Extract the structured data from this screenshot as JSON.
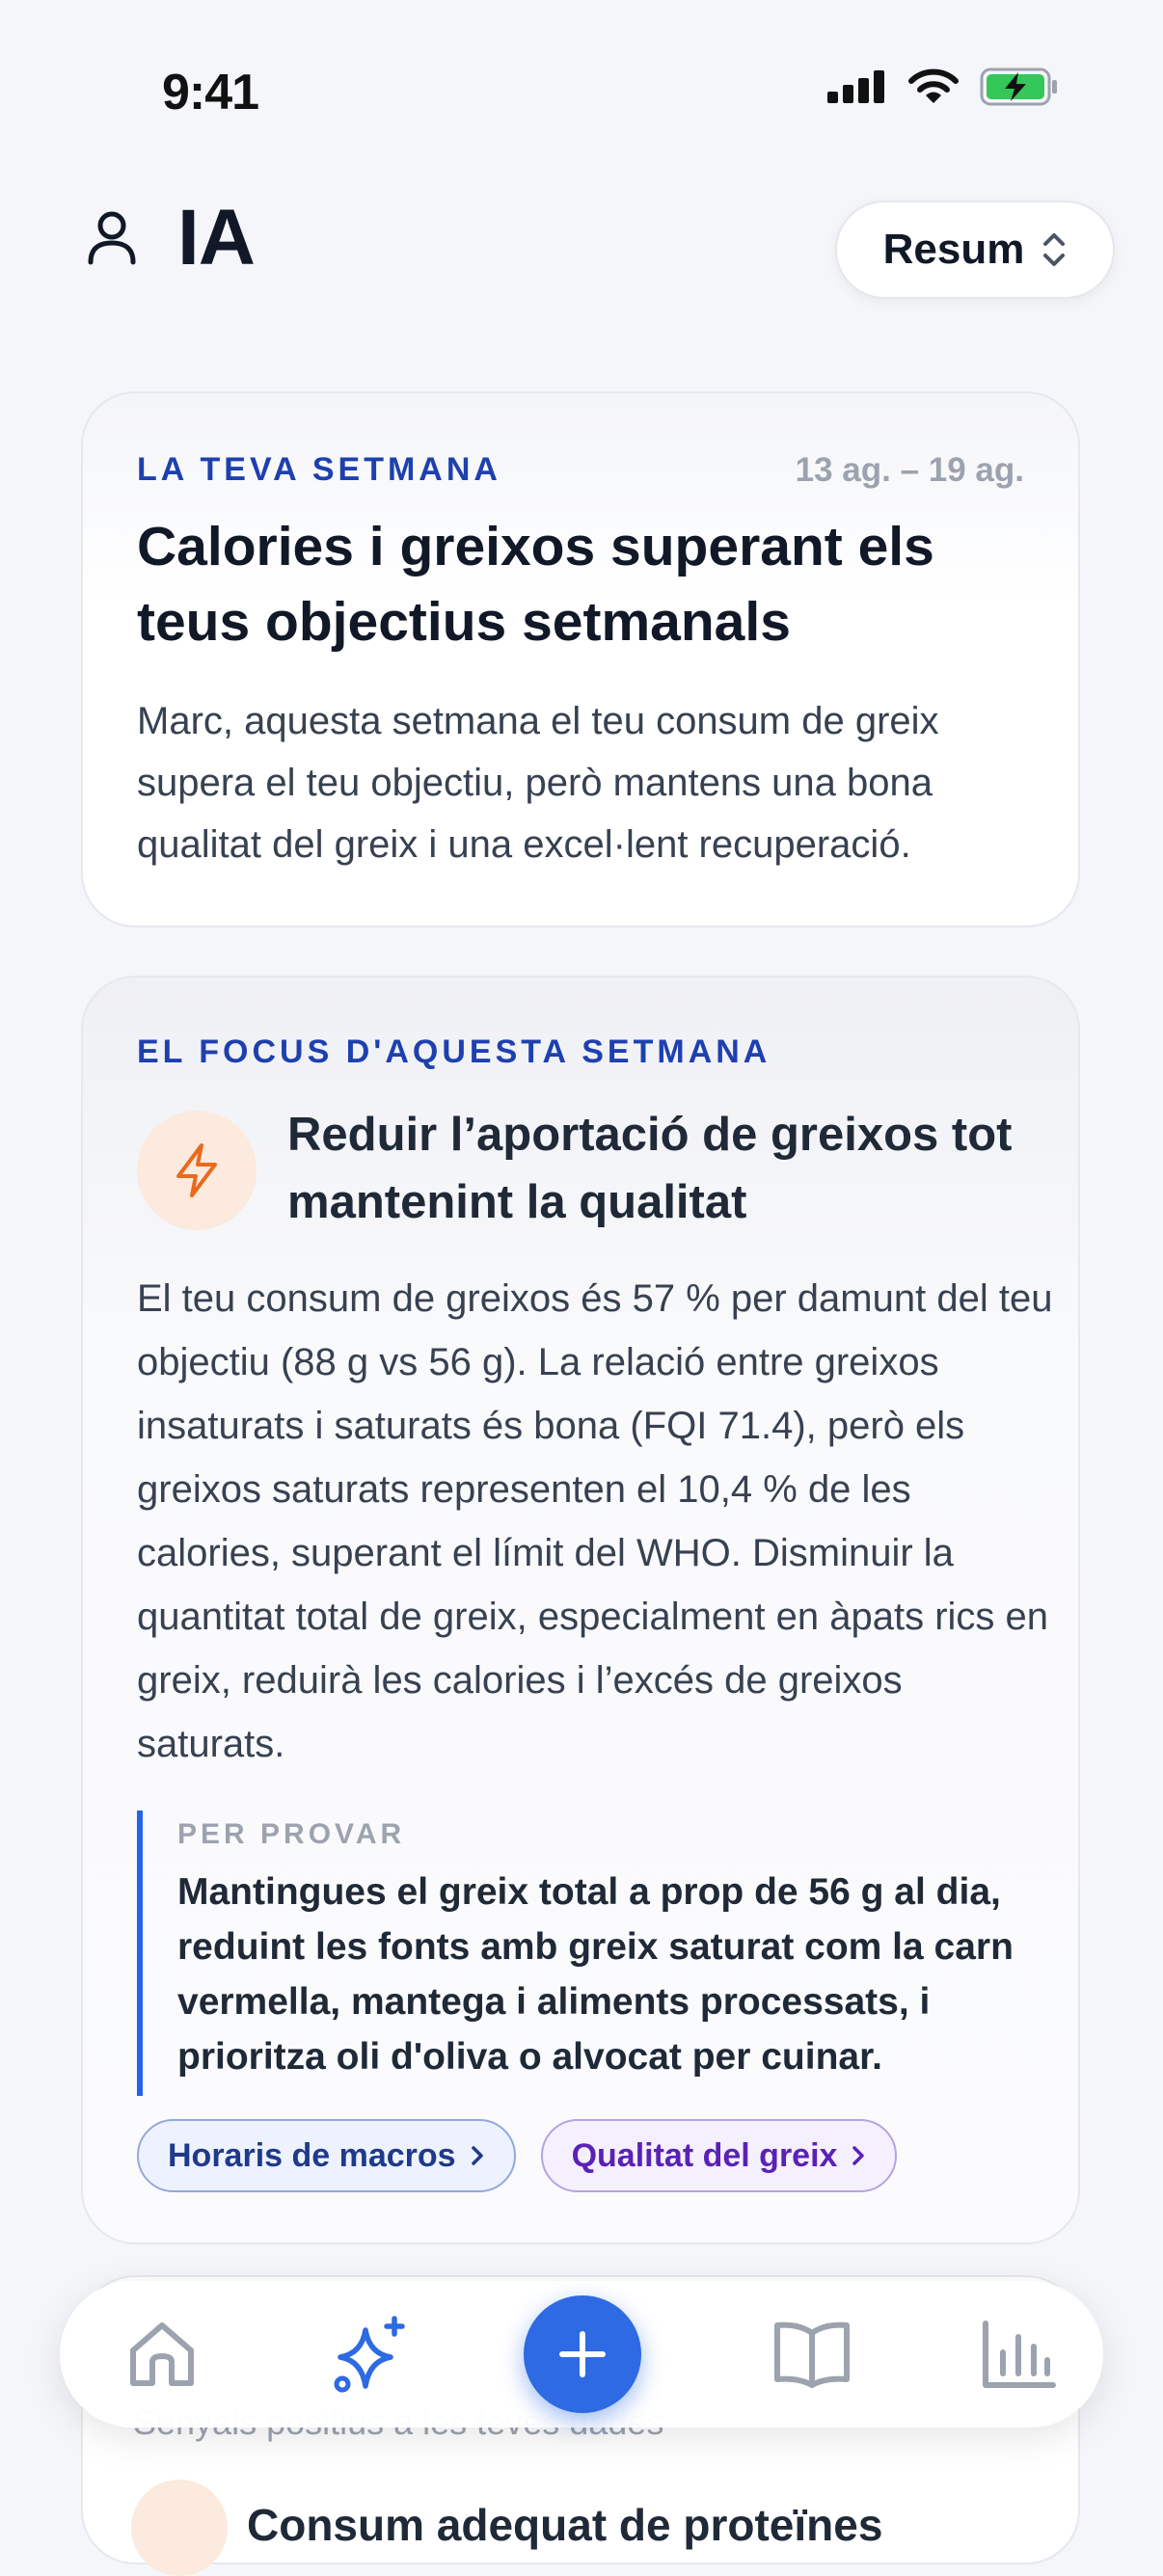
{
  "status_bar": {
    "time": "9:41"
  },
  "header": {
    "title": "IA",
    "view_selector": {
      "selected": "Resum"
    }
  },
  "week_card": {
    "eyebrow": "LA TEVA SETMANA",
    "date_range": "13 ag. – 19 ag.",
    "headline": "Calories i greixos superant els teus objectius setmanals",
    "body": "Marc, aquesta setmana el teu consum de greix supera el teu objectiu, però mantens una bona qualitat del greix i una excel·lent recuperació."
  },
  "focus_card": {
    "eyebrow": "EL FOCUS D'AQUESTA SETMANA",
    "icon": "lightning-icon",
    "title": "Reduir l’aportació de greixos tot mantenint la qualitat",
    "body": "El teu consum de greixos és 57 % per damunt del teu objectiu (88 g vs 56 g). La relació entre greixos insaturats i saturats és bona (FQI 71.4), però els greixos saturats representen el 10,4 % de les calories, superant el límit del WHO. Disminuir la quantitat total de greix, especialment en àpats rics en greix, reduirà les calories i l’excés de greixos saturats.",
    "tip": {
      "label": "PER PROVAR",
      "text": "Mantingues el greix total a prop de 56 g al dia, reduint les fonts amb greix saturat com la carn vermella, mantega i aliments processats, i prioritza oli d'oliva o alvocat per cuinar."
    },
    "chips": [
      {
        "label": "Horaris de macros",
        "color": "#1e3a8a"
      },
      {
        "label": "Qualitat del greix",
        "color": "#5b21b6"
      }
    ]
  },
  "signals_card": {
    "subtitle": "Senyals positius a les teves dades",
    "first_item": "Consum adequat de proteïnes"
  },
  "tab_bar": {
    "items": [
      "home-icon",
      "sparkles-icon",
      "add-icon",
      "book-icon",
      "chart-icon"
    ],
    "active": "sparkles-icon",
    "accent": "#2d6ae3"
  }
}
